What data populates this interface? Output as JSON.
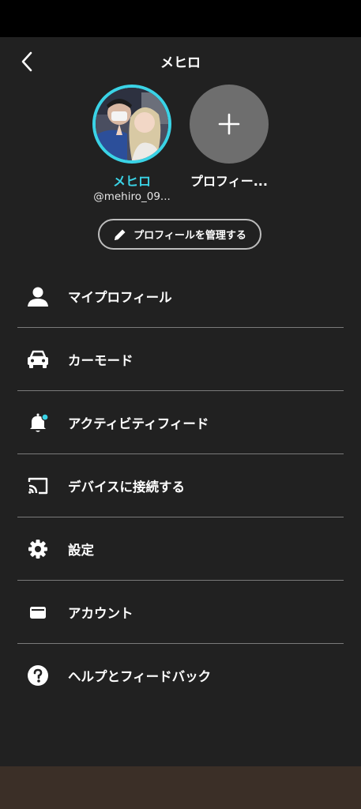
{
  "header": {
    "title": "メヒロ"
  },
  "profiles": [
    {
      "name": "メヒロ",
      "handle": "@mehiro_09..."
    },
    {
      "name": "プロフィー..."
    }
  ],
  "manage_button": {
    "label": "プロフィールを管理する"
  },
  "menu": {
    "items": [
      {
        "label": "マイプロフィール",
        "icon": "person-icon"
      },
      {
        "label": "カーモード",
        "icon": "car-icon"
      },
      {
        "label": "アクティビティフィード",
        "icon": "bell-icon"
      },
      {
        "label": "デバイスに接続する",
        "icon": "cast-icon"
      },
      {
        "label": "設定",
        "icon": "gear-icon"
      },
      {
        "label": "アカウント",
        "icon": "wallet-icon"
      },
      {
        "label": "ヘルプとフィードバック",
        "icon": "help-icon"
      }
    ]
  },
  "colors": {
    "background": "#212121",
    "accent": "#3ad3e6",
    "status_bar": "#000000",
    "bottom_bar": "#3b2f27",
    "divider": "#7a7a7a"
  }
}
